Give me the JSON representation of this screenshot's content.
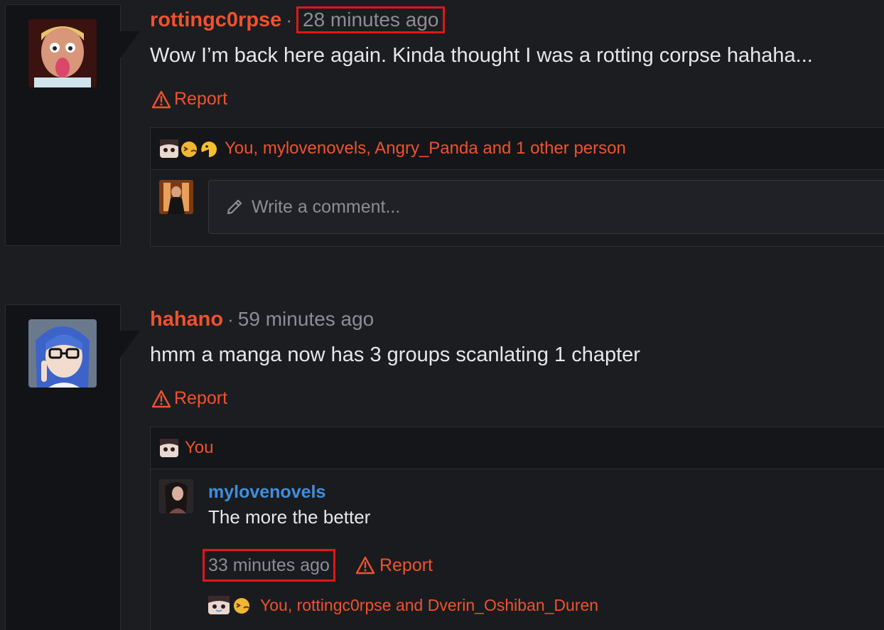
{
  "posts": [
    {
      "username": "rottingc0rpse",
      "separator": "·",
      "time": "28 minutes ago",
      "body": "Wow I’m back here again. Kinda thought I was a rotting corpse hahaha...",
      "report_label": "Report",
      "reactions_text": "You, mylovenovels, Angry_Panda and 1 other person",
      "comment_placeholder": "Write a comment..."
    },
    {
      "username": "hahano",
      "separator": "·",
      "time": "59 minutes ago",
      "body": "hmm a manga now has 3 groups scanlating 1 chapter",
      "report_label": "Report",
      "reactions_text": "You",
      "reply": {
        "username": "mylovenovels",
        "body": "The more the better",
        "time": "33 minutes ago",
        "report_label": "Report",
        "reactions_text": "You, rottingc0rpse and Dverin_Oshiban_Duren"
      }
    }
  ],
  "colors": {
    "accent": "#f0522d",
    "link_blue": "#3f8fdd",
    "highlight_box": "#e01717",
    "background": "#1c1d21"
  }
}
